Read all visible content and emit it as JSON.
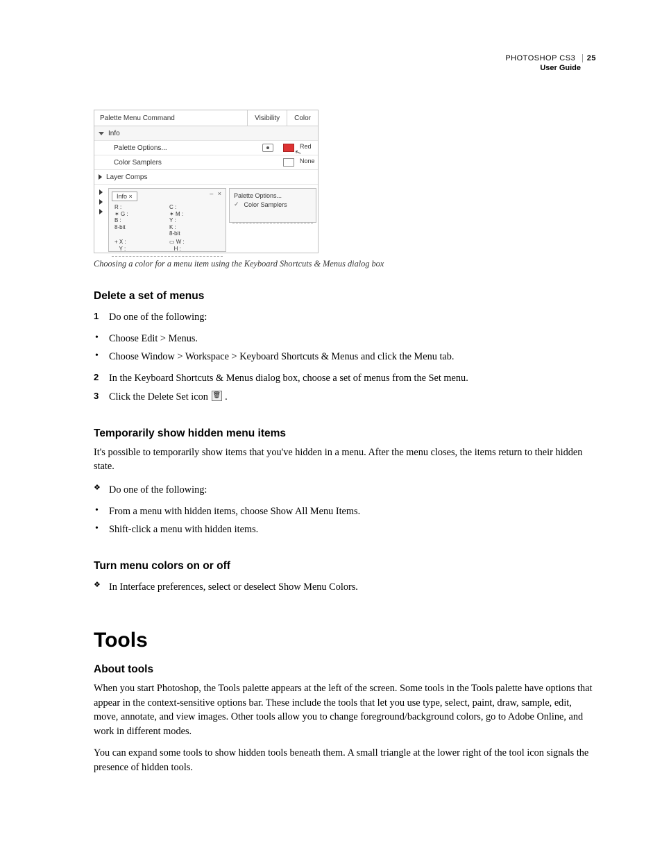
{
  "header": {
    "product": "PHOTOSHOP CS3",
    "page": "25",
    "subtitle": "User Guide"
  },
  "figure": {
    "col_title": "Palette Menu Command",
    "col_vis": "Visibility",
    "col_color": "Color",
    "row_info": "Info",
    "row_palette_options": "Palette Options...",
    "row_color_samplers": "Color Samplers",
    "row_layer_comps": "Layer Comps",
    "color_red": "Red",
    "color_none": "None",
    "panel_info_tab": "Info ×",
    "panel_cell_r": "R :",
    "panel_cell_g": "G :",
    "panel_cell_b": "B :",
    "panel_cell_c": "C :",
    "panel_cell_m": "M :",
    "panel_cell_y": "Y :",
    "panel_cell_k": "K :",
    "panel_cell_8bit": "8-bit",
    "panel_cell_x": "X :",
    "panel_cell_yy": "Y :",
    "panel_cell_w": "W :",
    "panel_cell_h": "H :",
    "menu_palette_options": "Palette Options...",
    "menu_color_samplers": "Color Samplers",
    "win_ctrl": "– ×"
  },
  "caption": "Choosing a color for a menu item using the Keyboard Shortcuts & Menus dialog box",
  "s1": {
    "title": "Delete a set of menus",
    "step1": "Do one of the following:",
    "b1": "Choose Edit > Menus.",
    "b2": "Choose Window > Workspace > Keyboard Shortcuts & Menus and click the Menu tab.",
    "step2": "In the Keyboard Shortcuts & Menus dialog box, choose a set of menus from the Set menu.",
    "step3a": "Click the Delete Set icon ",
    "step3b": " ."
  },
  "s2": {
    "title": "Temporarily show hidden menu items",
    "intro": "It's possible to temporarily show items that you've hidden in a menu. After the menu closes, the items return to their hidden state.",
    "d1": "Do one of the following:",
    "b1": "From a menu with hidden items, choose Show All Menu Items.",
    "b2": "Shift-click a menu with hidden items."
  },
  "s3": {
    "title": "Turn menu colors on or off",
    "d1": "In Interface preferences, select or deselect Show Menu Colors."
  },
  "tools": {
    "heading": "Tools",
    "sub": "About tools",
    "p1": "When you start Photoshop, the Tools palette appears at the left of the screen. Some tools in the Tools palette have options that appear in the context-sensitive options bar. These include the tools that let you use type, select, paint, draw, sample, edit, move, annotate, and view images. Other tools allow you to change foreground/background colors, go to Adobe Online, and work in different modes.",
    "p2": "You can expand some tools to show hidden tools beneath them. A small triangle at the lower right of the tool icon signals the presence of hidden tools."
  }
}
